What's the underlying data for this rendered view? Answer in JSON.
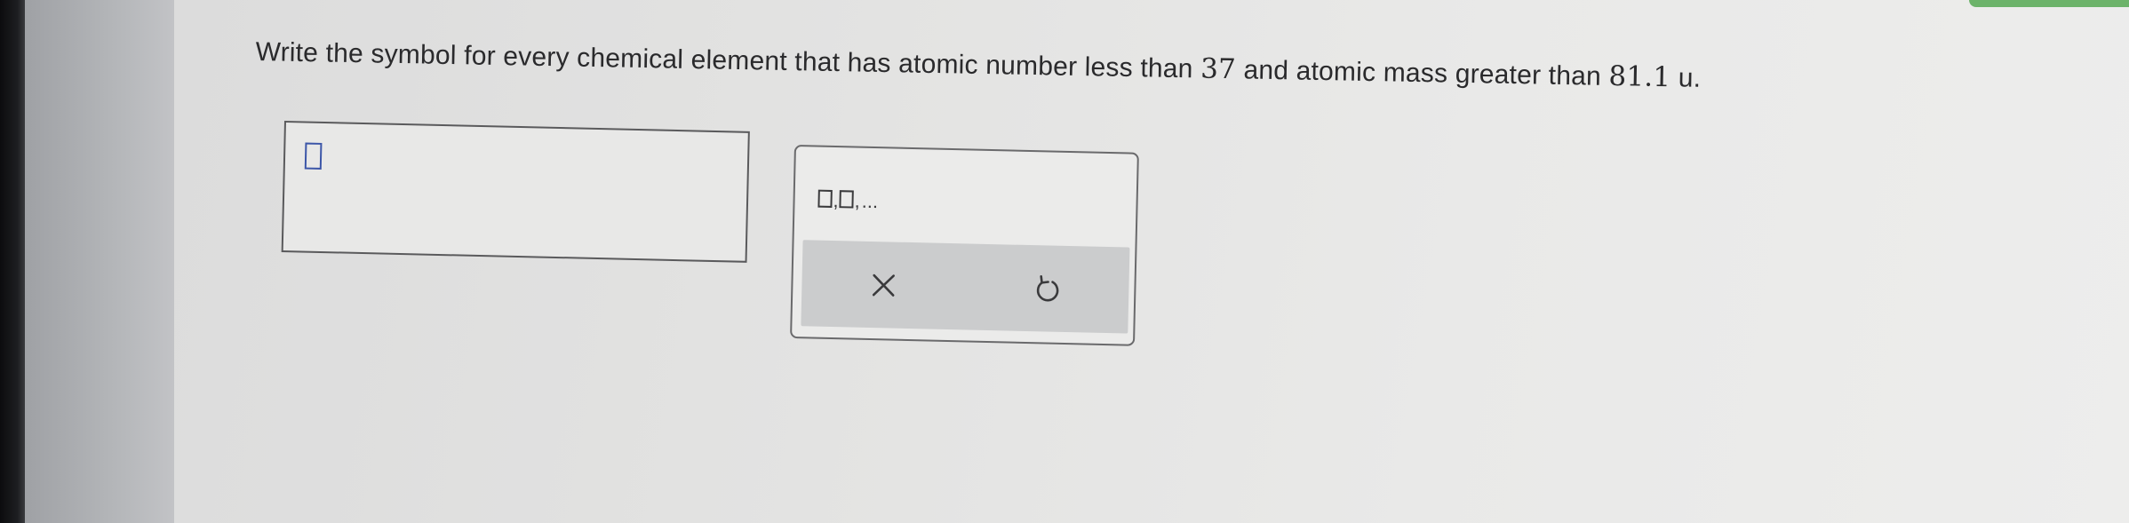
{
  "question": {
    "prefix": "Write the symbol for every chemical element that has atomic number less than ",
    "atomic_number_limit": "37",
    "middle": " and atomic mass greater than ",
    "atomic_mass_limit": "81.1",
    "unit": "u",
    "suffix": "."
  },
  "answer_input": {
    "value": ""
  },
  "keypad": {
    "list_template": {
      "separator": ",",
      "ellipsis": "..."
    },
    "clear_icon": "x-icon",
    "undo_icon": "undo-icon"
  },
  "colors": {
    "cursor": "#3c56a8",
    "accent_edge": "#6cb36a"
  }
}
